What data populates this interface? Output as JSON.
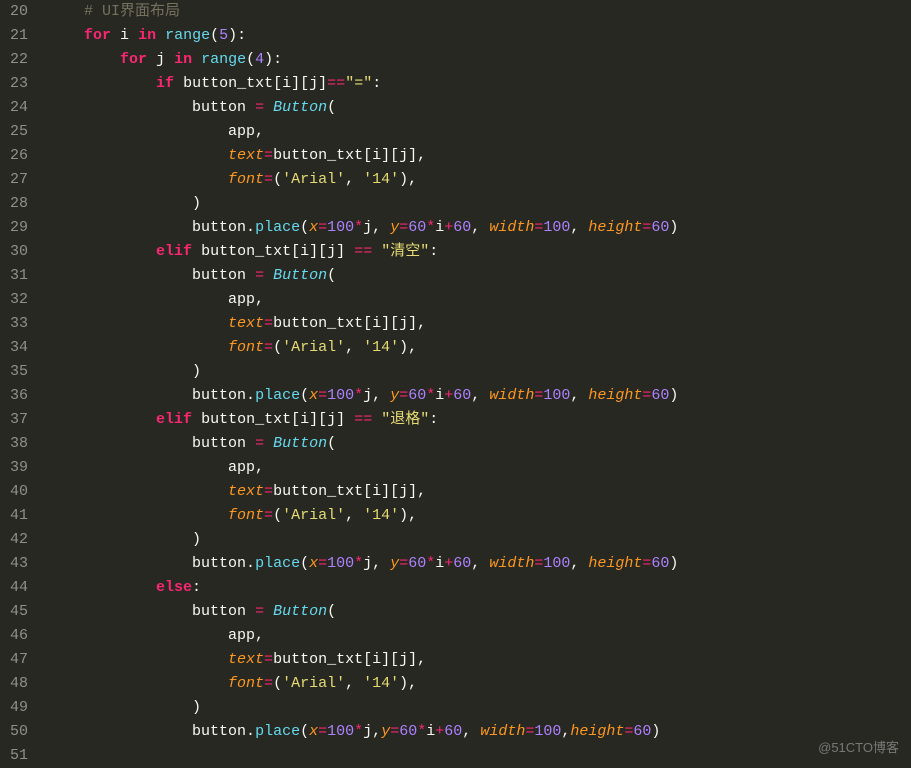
{
  "watermark": "@51CTO博客",
  "gutter": {
    "start": 20,
    "end": 51
  },
  "code": {
    "comment": "# UI界面布局",
    "for_kw": "for",
    "in_kw": "in",
    "if_kw": "if",
    "elif_kw": "elif",
    "else_kw": "else",
    "range_fn": "range",
    "button_class": "Button",
    "i": "i",
    "j": "j",
    "app": "app",
    "button": "button",
    "button_txt": "button_txt",
    "place_fn": "place",
    "outer_range": "5",
    "inner_range": "4",
    "param_text": "text",
    "param_font": "font",
    "param_x": "x",
    "param_y": "y",
    "param_width": "width",
    "param_height": "height",
    "eq_s": "\"=\"",
    "clear_s": "\"清空\"",
    "back_s": "\"退格\"",
    "font_tuple_open": "(",
    "font_tuple_close": ")",
    "comma": ",",
    "colon": ":",
    "arial": "'Arial'",
    "fsize": "'14'",
    "n100": "100",
    "n60": "60"
  }
}
